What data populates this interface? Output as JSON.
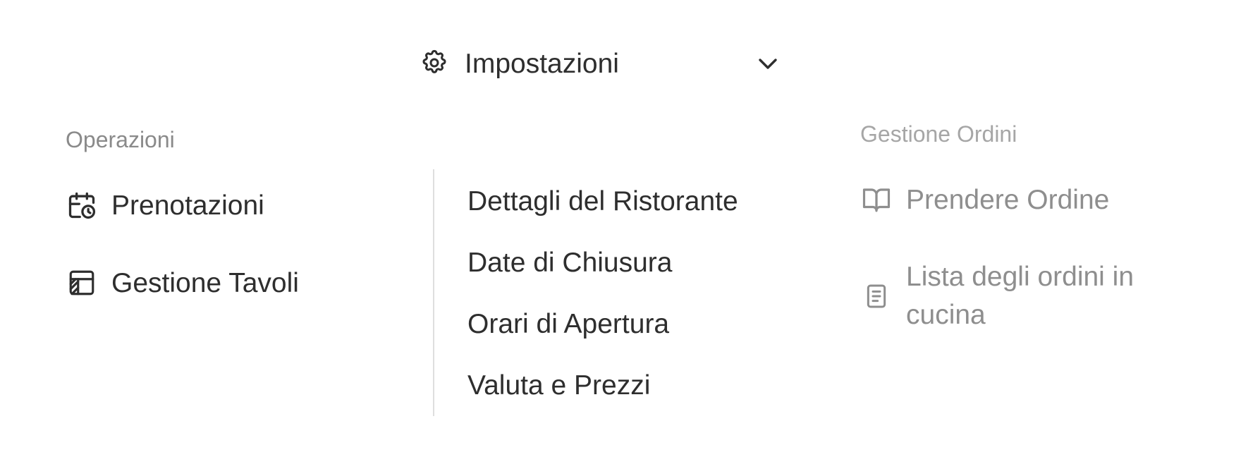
{
  "settings": {
    "label": "Impostazioni",
    "icon": "gear-icon",
    "expand_icon": "chevron-down-icon",
    "items": [
      {
        "label": "Dettagli del Ristorante"
      },
      {
        "label": "Date di Chiusura"
      },
      {
        "label": "Orari di Apertura"
      },
      {
        "label": "Valuta e Prezzi"
      }
    ]
  },
  "operations": {
    "label": "Operazioni",
    "items": [
      {
        "label": "Prenotazioni",
        "icon": "calendar-clock-icon"
      },
      {
        "label": "Gestione Tavoli",
        "icon": "table-layout-icon"
      }
    ]
  },
  "orders": {
    "label": "Gestione Ordini",
    "items": [
      {
        "label": "Prendere Ordine",
        "icon": "book-open-icon"
      },
      {
        "label": "Lista degli ordini in cucina",
        "icon": "document-list-icon"
      }
    ]
  },
  "colors": {
    "text": "#2e2e2e",
    "muted_text": "#8e8e8e",
    "section_label": "#8a8a8a",
    "divider": "#dedede",
    "background": "#ffffff"
  }
}
